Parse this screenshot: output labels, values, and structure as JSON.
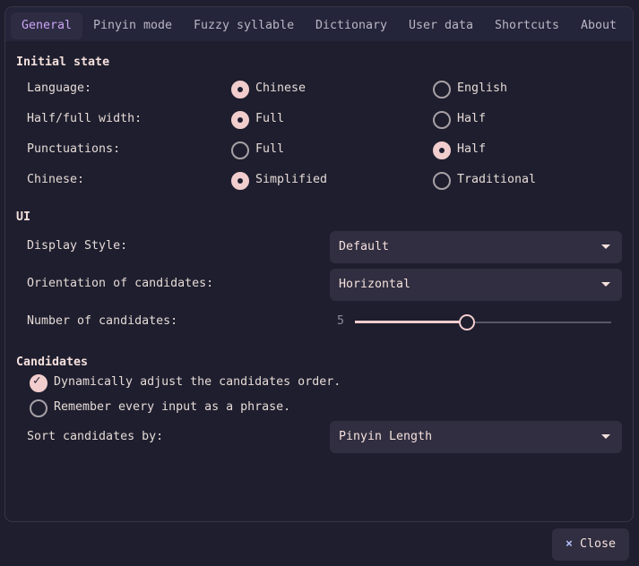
{
  "tabs": [
    "General",
    "Pinyin mode",
    "Fuzzy syllable",
    "Dictionary",
    "User data",
    "Shortcuts",
    "About"
  ],
  "active_tab": "General",
  "initial_state": {
    "title": "Initial state",
    "rows": [
      {
        "label": "Language:",
        "options": [
          "Chinese",
          "English"
        ],
        "selected": 0
      },
      {
        "label": "Half/full width:",
        "options": [
          "Full",
          "Half"
        ],
        "selected": 0
      },
      {
        "label": "Punctuations:",
        "options": [
          "Full",
          "Half"
        ],
        "selected": 1
      },
      {
        "label": "Chinese:",
        "options": [
          "Simplified",
          "Traditional"
        ],
        "selected": 0
      }
    ]
  },
  "ui": {
    "title": "UI",
    "display_style": {
      "label": "Display Style:",
      "value": "Default"
    },
    "orientation": {
      "label": "Orientation of candidates:",
      "value": "Horizontal"
    },
    "num_candidates": {
      "label": "Number of candidates:",
      "value": "5",
      "min": 1,
      "max": 10
    }
  },
  "candidates": {
    "title": "Candidates",
    "checks": [
      {
        "label": "Dynamically adjust the candidates order.",
        "checked": true
      },
      {
        "label": "Remember every input as a phrase.",
        "checked": false
      }
    ],
    "sort": {
      "label": "Sort candidates by:",
      "value": "Pinyin Length"
    }
  },
  "close_button": {
    "icon": "×",
    "label": "Close"
  },
  "colors": {
    "accent": "#f2cdcd",
    "active_tab": "#cba6f7",
    "background": "#1e1e2e",
    "close_icon": "#b4befe"
  }
}
